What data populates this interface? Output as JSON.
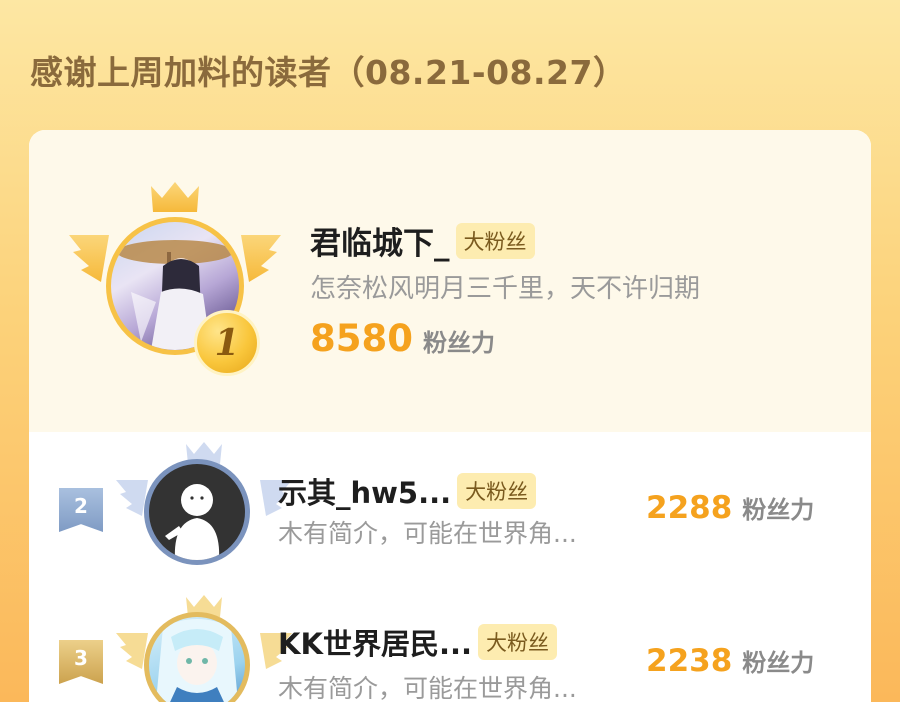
{
  "header": {
    "title": "感谢上周加料的读者（08.21-08.27）"
  },
  "colors": {
    "accent": "#f5a21e",
    "badge_bg": "#fdecb0",
    "title": "#8a6a3c"
  },
  "ranking": [
    {
      "rank": "1",
      "name": "君临城下_",
      "badge": "大粉丝",
      "bio": "怎奈松风明月三千里，天不许归期",
      "score": "8580",
      "score_unit": "粉丝力"
    },
    {
      "rank": "2",
      "name": "示其_hw5...",
      "badge": "大粉丝",
      "bio": "木有简介，可能在世界角...",
      "score": "2288",
      "score_unit": "粉丝力"
    },
    {
      "rank": "3",
      "name": "KK世界居民...",
      "badge": "大粉丝",
      "bio": "木有简介，可能在世界角...",
      "score": "2238",
      "score_unit": "粉丝力"
    }
  ]
}
